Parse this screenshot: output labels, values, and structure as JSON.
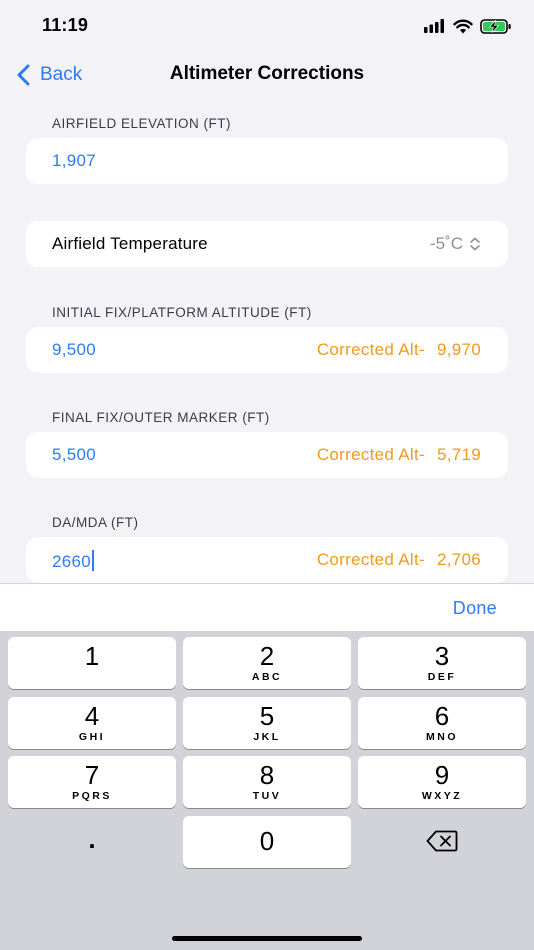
{
  "status_bar": {
    "time": "11:19"
  },
  "nav": {
    "back_label": "Back",
    "title": "Altimeter Corrections"
  },
  "airfield_elevation": {
    "label": "AIRFIELD ELEVATION (FT)",
    "value": "1,907"
  },
  "airfield_temperature": {
    "label": "Airfield Temperature",
    "value": "-5˚C"
  },
  "initial_fix": {
    "label": "INITIAL FIX/PLATFORM ALTITUDE (FT)",
    "value": "9,500",
    "corrected_label": "Corrected Alt-",
    "corrected_value": "9,970"
  },
  "final_fix": {
    "label": "FINAL FIX/OUTER MARKER (FT)",
    "value": "5,500",
    "corrected_label": "Corrected Alt-",
    "corrected_value": "5,719"
  },
  "da_mda": {
    "label": "DA/MDA (FT)",
    "value": "2660",
    "corrected_label": "Corrected Alt-",
    "corrected_value": "2,706"
  },
  "accessory": {
    "done_label": "Done"
  },
  "keyboard": {
    "keys": [
      {
        "digit": "1",
        "letters": ""
      },
      {
        "digit": "2",
        "letters": "ABC"
      },
      {
        "digit": "3",
        "letters": "DEF"
      },
      {
        "digit": "4",
        "letters": "GHI"
      },
      {
        "digit": "5",
        "letters": "JKL"
      },
      {
        "digit": "6",
        "letters": "MNO"
      },
      {
        "digit": "7",
        "letters": "PQRS"
      },
      {
        "digit": "8",
        "letters": "TUV"
      },
      {
        "digit": "9",
        "letters": "WXYZ"
      }
    ],
    "decimal": ".",
    "zero": "0"
  },
  "colors": {
    "accent": "#2f7bf6",
    "corrected": "#f09a1e",
    "background": "#f2f2f7",
    "keyboard": "#d1d3d9"
  },
  "icons": [
    "signal-icon",
    "wifi-icon",
    "battery-charging-icon",
    "chevron-left-icon",
    "up-down-chevron-icon",
    "backspace-icon"
  ]
}
